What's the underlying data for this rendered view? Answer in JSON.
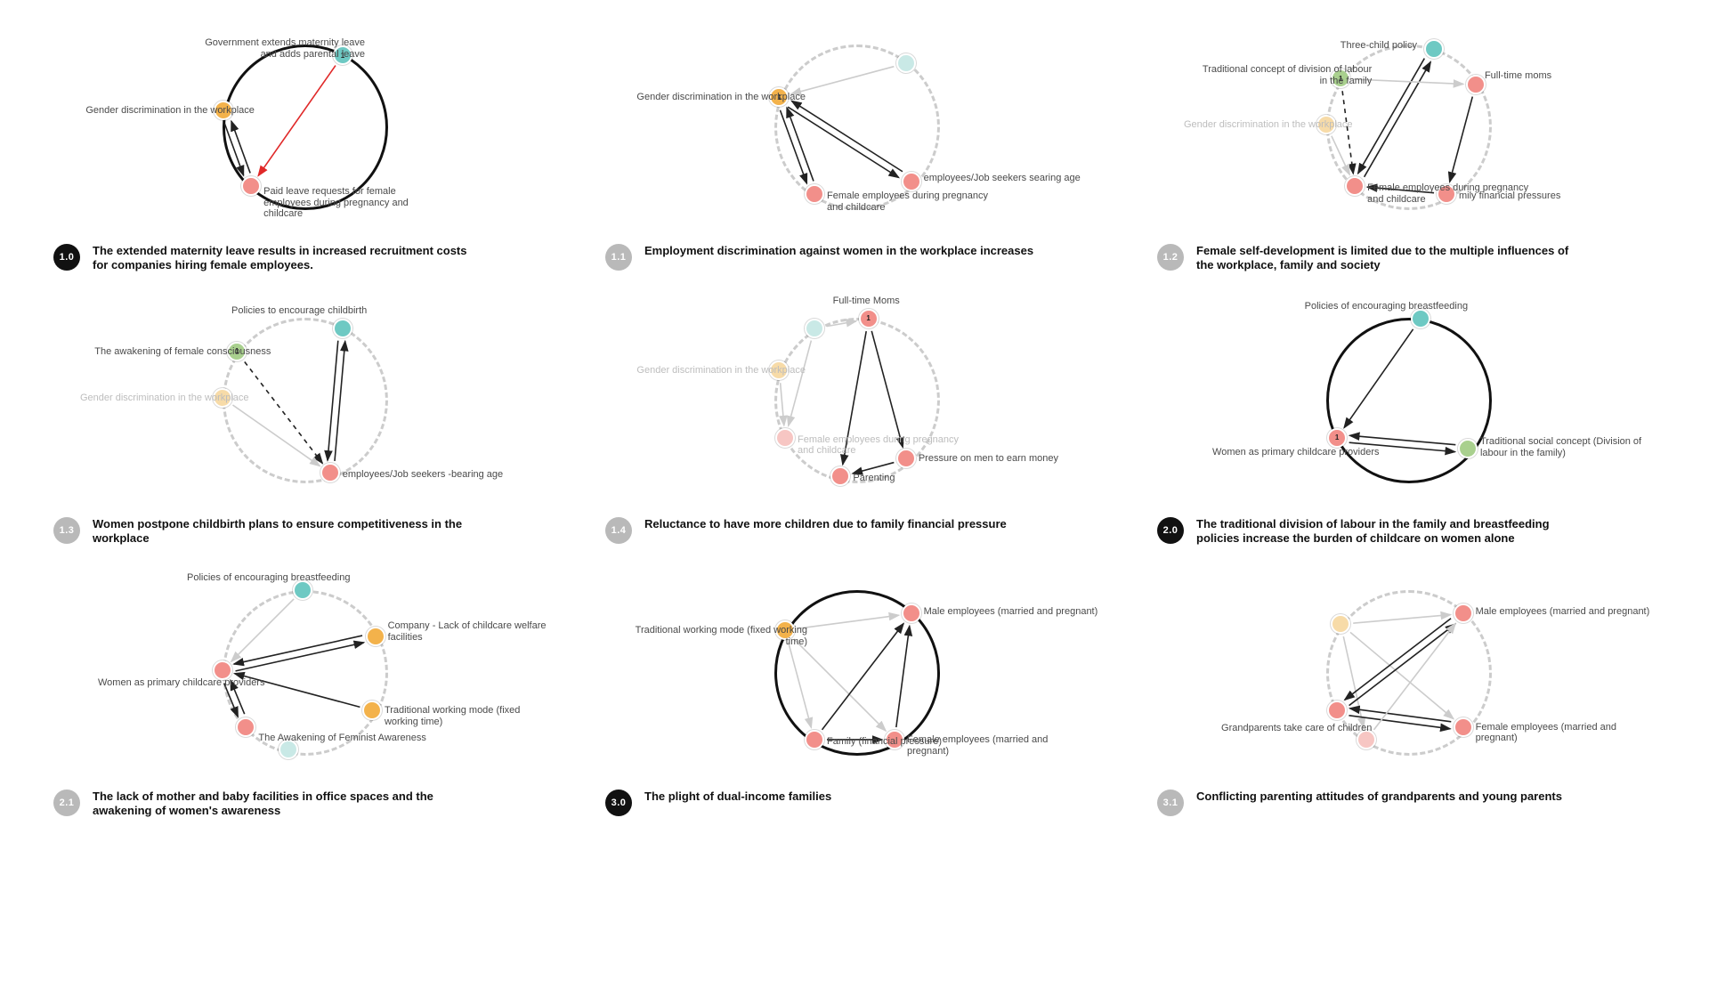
{
  "colors": {
    "teal": "#6ec9c3",
    "tealFaded": "#c9e9e6",
    "orange": "#f3b24b",
    "orangeFaded": "#f7dba8",
    "pink": "#f28f8a",
    "pinkFaded": "#f7c6c3",
    "green": "#a9d08e"
  },
  "panels": [
    {
      "badge": "1.0",
      "primary": true,
      "title": "The extended maternity leave results in increased recruitment costs for companies hiring female employees.",
      "solidRing": true,
      "nodes": [
        {
          "id": "A",
          "angle": -60,
          "color": "teal",
          "num": "1",
          "label": "Government extends maternity leave and adds parental leave",
          "labelPos": "left",
          "labelDX": -175,
          "labelDY": -20
        },
        {
          "id": "B",
          "angle": 130,
          "color": "pink",
          "label": "Paid leave requests for female employees during pregnancy and childcare",
          "labelPos": "right",
          "labelDX": 14,
          "labelDY": 0
        },
        {
          "id": "C",
          "angle": 190,
          "color": "orange",
          "label": "Gender discrimination in the workplace",
          "labelPos": "left",
          "labelDX": -155,
          "labelDY": -6
        }
      ],
      "arrows": [
        [
          "A",
          "B",
          "red"
        ],
        [
          "B",
          "C",
          "solid"
        ],
        [
          "C",
          "B",
          "solid"
        ]
      ]
    },
    {
      "badge": "1.1",
      "primary": false,
      "title": "Employment discrimination against women in the workplace increases",
      "solidRing": false,
      "nodes": [
        {
          "id": "A",
          "angle": -50,
          "color": "tealFaded",
          "label": "",
          "labelPos": "none"
        },
        {
          "id": "B",
          "angle": 45,
          "color": "pink",
          "label": "employees/Job seekers searing age",
          "labelPos": "right",
          "labelDX": 14,
          "labelDY": -10
        },
        {
          "id": "C",
          "angle": 120,
          "color": "pink",
          "label": "Female employees during pregnancy and childcare",
          "labelPos": "right",
          "labelDX": 14,
          "labelDY": -4
        },
        {
          "id": "D",
          "angle": 200,
          "color": "orange",
          "num": "1",
          "label": "Gender discrimination in the workplace",
          "labelPos": "left",
          "labelDX": -160,
          "labelDY": -6
        }
      ],
      "arrows": [
        [
          "A",
          "D",
          "light"
        ],
        [
          "D",
          "B",
          "solid"
        ],
        [
          "B",
          "D",
          "solid"
        ],
        [
          "D",
          "C",
          "solid"
        ],
        [
          "C",
          "D",
          "solid"
        ]
      ]
    },
    {
      "badge": "1.2",
      "primary": false,
      "title": "Female self-development is limited due to the multiple influences of the workplace, family and society",
      "solidRing": false,
      "nodes": [
        {
          "id": "A",
          "angle": -70,
          "color": "teal",
          "label": "Three-child policy",
          "labelPos": "left",
          "labelDX": -105,
          "labelDY": -10
        },
        {
          "id": "B",
          "angle": -30,
          "color": "pink",
          "label": "Full-time moms",
          "labelPos": "right",
          "labelDX": 10,
          "labelDY": -16
        },
        {
          "id": "C",
          "angle": 60,
          "color": "pink",
          "label": "mily financial pressures",
          "labelPos": "right",
          "labelDX": 14,
          "labelDY": -4
        },
        {
          "id": "D",
          "angle": 130,
          "color": "pink",
          "label": "Female employees during pregnancy and childcare",
          "labelPos": "right",
          "labelDX": 14,
          "labelDY": -4
        },
        {
          "id": "E",
          "angle": 180,
          "color": "orangeFaded",
          "label": "Gender discrimination in the workplace",
          "faded": true,
          "labelPos": "left",
          "labelDX": -160,
          "labelDY": -6
        },
        {
          "id": "F",
          "angle": 215,
          "color": "green",
          "num": "1",
          "label": "Traditional concept of division of labour in the family",
          "labelPos": "left",
          "labelDX": -165,
          "labelDY": -16
        }
      ],
      "arrows": [
        [
          "A",
          "D",
          "solid"
        ],
        [
          "B",
          "C",
          "solid"
        ],
        [
          "C",
          "D",
          "solid"
        ],
        [
          "D",
          "A",
          "solid"
        ],
        [
          "F",
          "D",
          "dashed"
        ],
        [
          "E",
          "D",
          "light"
        ],
        [
          "F",
          "B",
          "light"
        ]
      ]
    },
    {
      "badge": "1.3",
      "primary": false,
      "title": "Women postpone childbirth plans to ensure competitiveness in the workplace",
      "solidRing": false,
      "nodes": [
        {
          "id": "A",
          "angle": -60,
          "color": "teal",
          "label": "Policies to encourage childbirth",
          "labelPos": "right",
          "labelDX": -125,
          "labelDY": -26
        },
        {
          "id": "B",
          "angle": 70,
          "color": "pink",
          "label": "employees/Job seekers -bearing age",
          "labelPos": "right",
          "labelDX": 14,
          "labelDY": -4
        },
        {
          "id": "C",
          "angle": 180,
          "color": "orangeFaded",
          "label": "Gender discrimination in the workplace",
          "faded": true,
          "labelPos": "left",
          "labelDX": -160,
          "labelDY": -6
        },
        {
          "id": "D",
          "angle": 215,
          "color": "green",
          "num": "1",
          "label": "The awakening of female consciousness",
          "labelPos": "left",
          "labelDX": -160,
          "labelDY": -6
        }
      ],
      "arrows": [
        [
          "A",
          "B",
          "solid"
        ],
        [
          "B",
          "A",
          "solid"
        ],
        [
          "D",
          "B",
          "dashed"
        ],
        [
          "C",
          "B",
          "light"
        ]
      ]
    },
    {
      "badge": "1.4",
      "primary": false,
      "title": "Reluctance to have more children due to family financial pressure",
      "solidRing": false,
      "nodes": [
        {
          "id": "A",
          "angle": -80,
          "color": "pink",
          "num": "1",
          "label": "Full-time Moms",
          "labelPos": "right",
          "labelDX": -40,
          "labelDY": -26
        },
        {
          "id": "B",
          "angle": 50,
          "color": "pink",
          "label": "Pressure on men to earn money",
          "labelPos": "right",
          "labelDX": 14,
          "labelDY": -6
        },
        {
          "id": "C",
          "angle": 100,
          "color": "pink",
          "label": "Parenting",
          "labelPos": "right",
          "labelDX": 14,
          "labelDY": -4
        },
        {
          "id": "D",
          "angle": 150,
          "color": "pinkFaded",
          "label": "Female employees during pregnancy and childcare",
          "faded": true,
          "labelPos": "right",
          "labelDX": 14,
          "labelDY": -4
        },
        {
          "id": "E",
          "angle": 200,
          "color": "orangeFaded",
          "label": "Gender discrimination in the workplace",
          "faded": true,
          "labelPos": "left",
          "labelDX": -160,
          "labelDY": -6
        },
        {
          "id": "F",
          "angle": 240,
          "color": "tealFaded",
          "label": "",
          "labelPos": "none"
        }
      ],
      "arrows": [
        [
          "A",
          "B",
          "solid"
        ],
        [
          "A",
          "C",
          "solid"
        ],
        [
          "B",
          "C",
          "solid"
        ],
        [
          "F",
          "D",
          "light"
        ],
        [
          "E",
          "D",
          "light"
        ],
        [
          "F",
          "A",
          "light"
        ]
      ]
    },
    {
      "badge": "2.0",
      "primary": true,
      "title": "The traditional division of labour in the family and breastfeeding policies increase the burden of childcare on women alone",
      "solidRing": true,
      "nodes": [
        {
          "id": "A",
          "angle": -80,
          "color": "teal",
          "label": "Policies of encouraging breastfeeding",
          "labelPos": "left",
          "labelDX": -130,
          "labelDY": -20
        },
        {
          "id": "B",
          "angle": 40,
          "color": "green",
          "label": "Traditional social concept (Division of labour in the family)",
          "labelPos": "right",
          "labelDX": 14,
          "labelDY": -14
        },
        {
          "id": "C",
          "angle": 150,
          "color": "pink",
          "num": "1",
          "label": "Women as primary childcare providers",
          "labelPos": "left",
          "labelDX": -140,
          "labelDY": 10
        }
      ],
      "arrows": [
        [
          "A",
          "C",
          "solid"
        ],
        [
          "B",
          "C",
          "solid"
        ],
        [
          "C",
          "B",
          "solid"
        ]
      ]
    },
    {
      "badge": "2.1",
      "primary": false,
      "title": "The lack of mother and baby facilities in office spaces and the awakening of women's awareness",
      "solidRing": false,
      "nodes": [
        {
          "id": "A",
          "angle": -90,
          "color": "teal",
          "label": "Policies of encouraging breastfeeding",
          "labelPos": "left",
          "labelDX": -130,
          "labelDY": -20
        },
        {
          "id": "B",
          "angle": -25,
          "color": "orange",
          "label": "Company - Lack of childcare welfare facilities",
          "labelPos": "right",
          "labelDX": 14,
          "labelDY": -18
        },
        {
          "id": "C",
          "angle": 30,
          "color": "orange",
          "label": "Traditional working mode (fixed working time)",
          "labelPos": "right",
          "labelDX": 14,
          "labelDY": -6
        },
        {
          "id": "D",
          "angle": 100,
          "color": "tealFaded",
          "label": "",
          "labelPos": "none"
        },
        {
          "id": "E",
          "angle": 135,
          "color": "pink",
          "label": "The Awakening of Feminist Awareness",
          "labelPos": "right",
          "labelDX": 14,
          "labelDY": 6
        },
        {
          "id": "F",
          "angle": 180,
          "color": "pink",
          "label": "Women as primary childcare providers",
          "labelPos": "left",
          "labelDX": -140,
          "labelDY": 8
        }
      ],
      "arrows": [
        [
          "A",
          "F",
          "light"
        ],
        [
          "B",
          "F",
          "solid"
        ],
        [
          "C",
          "F",
          "solid"
        ],
        [
          "F",
          "E",
          "solid"
        ],
        [
          "E",
          "F",
          "solid"
        ],
        [
          "F",
          "B",
          "solid"
        ]
      ]
    },
    {
      "badge": "3.0",
      "primary": true,
      "title": "The plight of dual-income families",
      "solidRing": true,
      "nodes": [
        {
          "id": "A",
          "angle": -45,
          "color": "pink",
          "label": "Male employees (married and pregnant)",
          "labelPos": "right",
          "labelDX": 14,
          "labelDY": -8
        },
        {
          "id": "B",
          "angle": 60,
          "color": "pink",
          "label": "Female employees (married and pregnant)",
          "labelPos": "right",
          "labelDX": 14,
          "labelDY": -6
        },
        {
          "id": "C",
          "angle": 120,
          "color": "pink",
          "label": "Family (financial pressure)",
          "labelPos": "right",
          "labelDX": 14,
          "labelDY": -4
        },
        {
          "id": "D",
          "angle": 210,
          "color": "orange",
          "label": "Traditional working mode (fixed working time)",
          "labelPos": "left",
          "labelDX": -175,
          "labelDY": -6
        }
      ],
      "arrows": [
        [
          "D",
          "A",
          "light"
        ],
        [
          "D",
          "B",
          "light"
        ],
        [
          "D",
          "C",
          "light"
        ],
        [
          "C",
          "A",
          "solid"
        ],
        [
          "C",
          "B",
          "solid"
        ],
        [
          "B",
          "A",
          "solid"
        ]
      ]
    },
    {
      "badge": "3.1",
      "primary": false,
      "title": "Conflicting parenting attitudes of grandparents and young parents",
      "solidRing": false,
      "nodes": [
        {
          "id": "A",
          "angle": -45,
          "color": "pink",
          "label": "Male employees (married and pregnant)",
          "labelPos": "right",
          "labelDX": 14,
          "labelDY": -8
        },
        {
          "id": "B",
          "angle": 45,
          "color": "pink",
          "label": "Female employees (married and pregnant)",
          "labelPos": "right",
          "labelDX": 14,
          "labelDY": -6
        },
        {
          "id": "C",
          "angle": 120,
          "color": "pinkFaded",
          "label": "",
          "labelPos": "none"
        },
        {
          "id": "D",
          "angle": 150,
          "color": "pink",
          "label": "Grandparents take care of children",
          "labelPos": "left",
          "labelDX": -130,
          "labelDY": 14
        },
        {
          "id": "E",
          "angle": 215,
          "color": "orangeFaded",
          "label": "",
          "labelPos": "none"
        }
      ],
      "arrows": [
        [
          "E",
          "A",
          "light"
        ],
        [
          "E",
          "B",
          "light"
        ],
        [
          "E",
          "C",
          "light"
        ],
        [
          "D",
          "A",
          "solid"
        ],
        [
          "A",
          "D",
          "solid"
        ],
        [
          "D",
          "B",
          "solid"
        ],
        [
          "B",
          "D",
          "solid"
        ],
        [
          "C",
          "A",
          "light"
        ]
      ]
    }
  ]
}
